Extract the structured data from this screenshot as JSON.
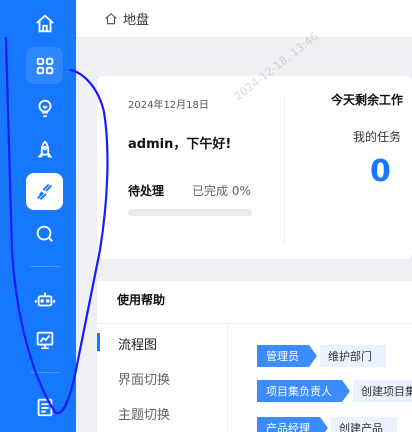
{
  "sidebar": {
    "items": [
      {
        "icon": "home-icon"
      },
      {
        "icon": "grid-icon",
        "state": "hover"
      },
      {
        "icon": "lightbulb-icon"
      },
      {
        "icon": "rocket-icon"
      },
      {
        "icon": "run-icon",
        "state": "selected"
      },
      {
        "icon": "search-icon"
      },
      {
        "icon": "robot-icon"
      },
      {
        "icon": "chart-board-icon"
      },
      {
        "icon": "document-icon"
      }
    ]
  },
  "header": {
    "breadcrumb": "地盘",
    "home_icon": "home-icon"
  },
  "welcome": {
    "date": "2024年12月18日",
    "greeting": "admin，下午好!",
    "pending_label": "待处理",
    "done_label": "已完成 0%",
    "progress": 0
  },
  "today": {
    "title": "今天剩余工作",
    "my_tasks_label": "我的任务",
    "my_tasks_count": "0"
  },
  "help": {
    "title": "使用帮助",
    "menu": [
      "流程图",
      "界面切换",
      "主题切换"
    ],
    "flow": [
      {
        "role": "管理员",
        "action": "维护部门"
      },
      {
        "role": "项目集负责人",
        "action": "创建项目集"
      },
      {
        "role": "产品经理",
        "action": "创建产品"
      }
    ]
  },
  "watermark": "2024-12-18, 13:46",
  "colors": {
    "primary": "#1677ff",
    "background": "#eef0f4",
    "pen": "#1a1aff"
  }
}
